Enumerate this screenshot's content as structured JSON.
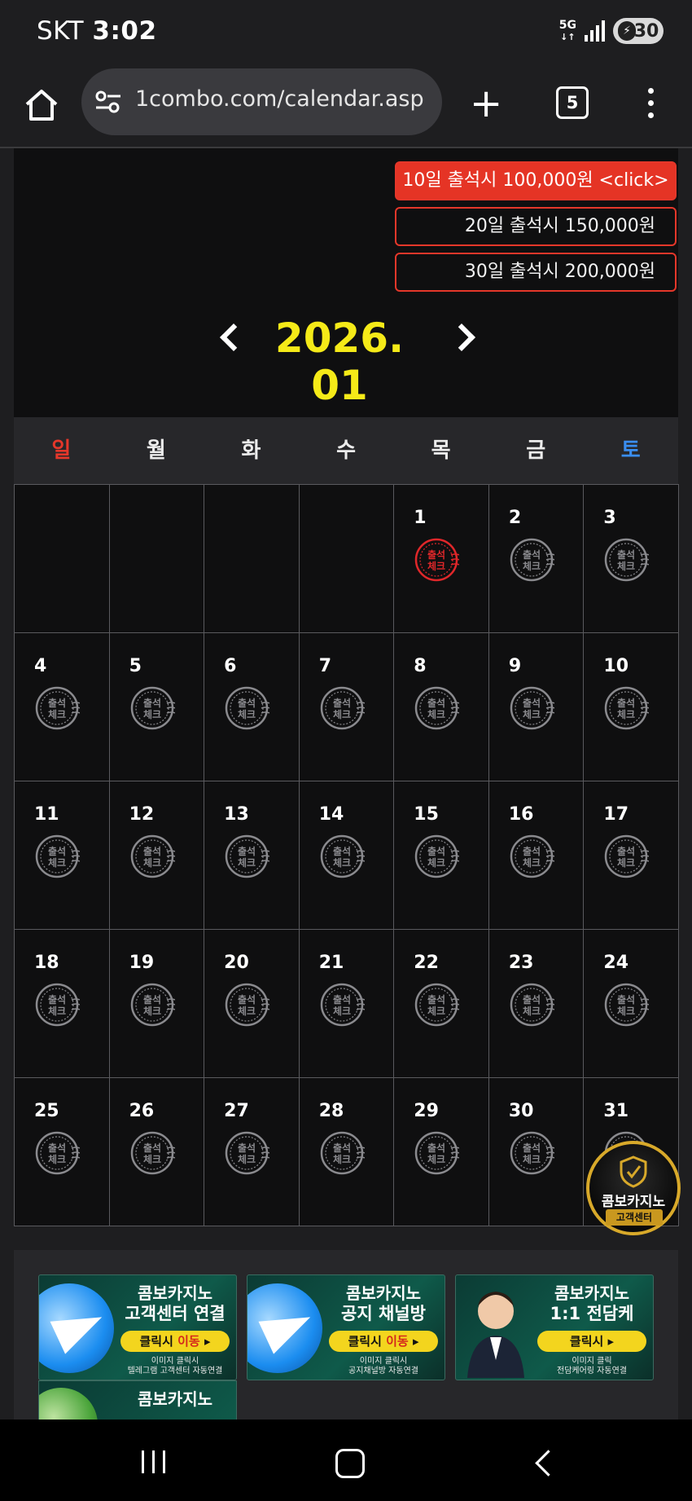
{
  "status_bar": {
    "carrier": "SKT",
    "time": "3:02",
    "network": "5G",
    "battery": "30"
  },
  "browser": {
    "url": "1combo.com/calendar.asp",
    "tab_count": "5"
  },
  "promos": [
    {
      "label": "10일 출석시 100,000원 <click>",
      "active": true
    },
    {
      "label": "20일 출석시 150,000원",
      "active": false
    },
    {
      "label": "30일 출석시 200,000원",
      "active": false
    }
  ],
  "calendar": {
    "month_label": "2026. 01",
    "weekdays": [
      "일",
      "월",
      "화",
      "수",
      "목",
      "금",
      "토"
    ],
    "leading_blanks": 4,
    "days": 31,
    "checked_days": [
      1
    ],
    "stamp_text": "출석\n체크"
  },
  "banners": [
    {
      "line1": "콤보카지노",
      "line2": "고객센터 연결",
      "button": "클릭시",
      "button_em": "이동",
      "note": "이미지 클릭시\n텔레그램 고객센터 자동연결"
    },
    {
      "line1": "콤보카지노",
      "line2": "공지 채널방",
      "button": "클릭시",
      "button_em": "이동",
      "note": "이미지 클릭시\n공지채널방 자동연결"
    },
    {
      "line1": "콤보카지노",
      "line2": "1:1 전담케",
      "button": "클릭시",
      "button_em": "",
      "note": "이미지 클릭\n전담케어링 자동연결"
    }
  ],
  "partial_banner": {
    "line1": "콤보카지노"
  },
  "cs_badge": {
    "line1": "콤보카지노",
    "line2": "고객센터"
  },
  "colors": {
    "accent_red": "#e53425",
    "month_yellow": "#f5ea18",
    "saturday_blue": "#3a8ef0"
  }
}
